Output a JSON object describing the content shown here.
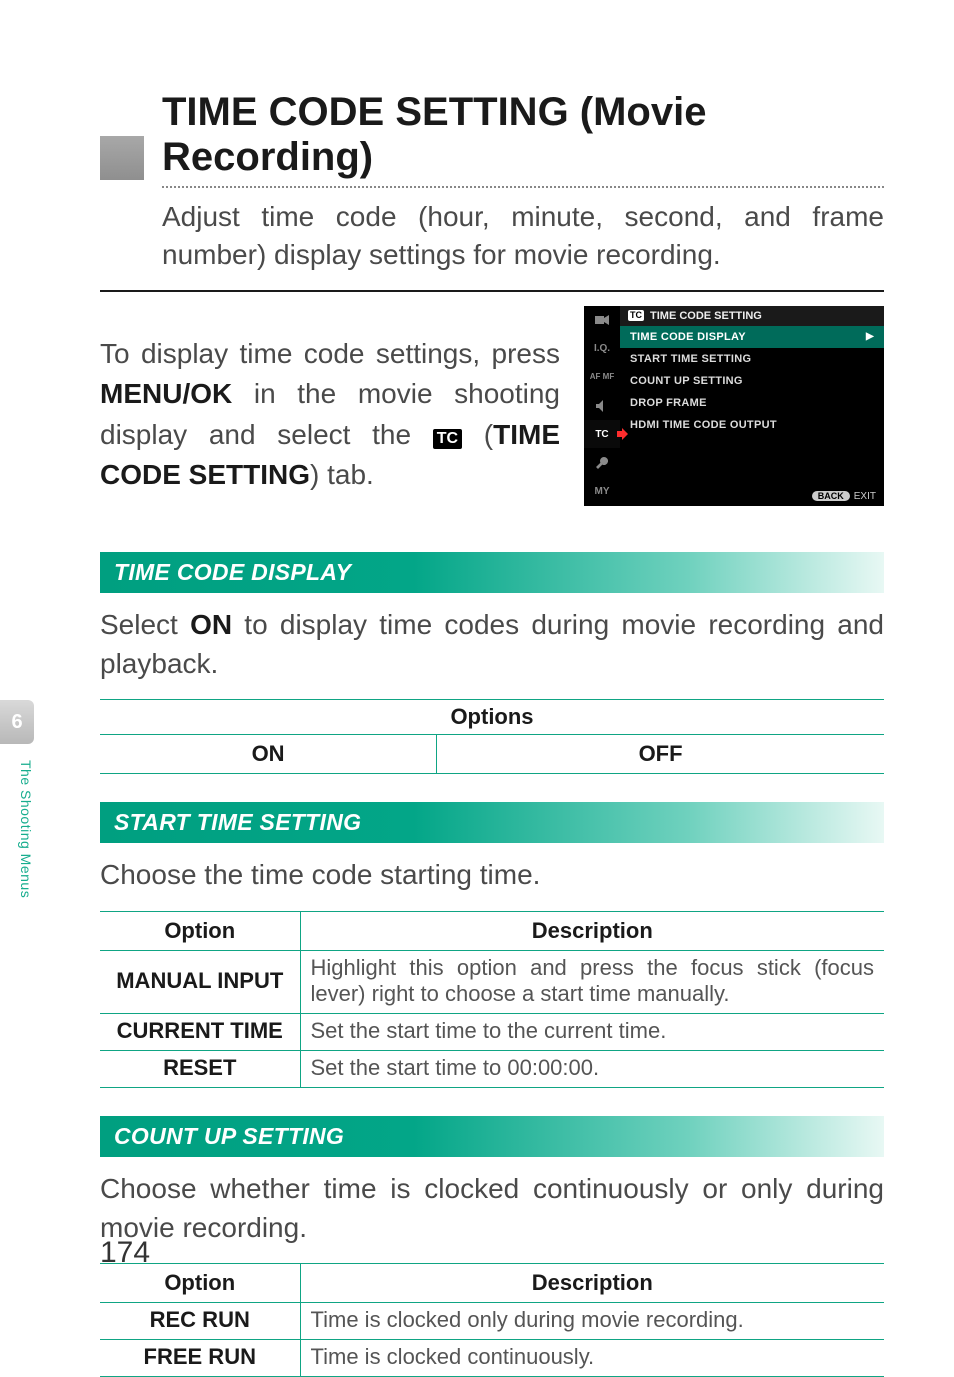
{
  "domain": "Document",
  "page_number": "174",
  "chapter_tab": {
    "num": "6",
    "label": "The Shooting Menus"
  },
  "title": "TIME CODE SETTING (Movie Recording)",
  "lead": "Adjust time code (hour, minute, second, and frame number) display settings for movie recording.",
  "step": {
    "pre": "To display time code settings, press ",
    "menu_ok": "MENU/OK",
    "mid": " in the movie shooting display and select the ",
    "tc_glyph": "TC",
    "setting_name": "TIME CODE SETTING",
    "post": ") tab."
  },
  "osd": {
    "header_glyph": "TC",
    "header": "TIME CODE SETTING",
    "gutter": [
      {
        "label": "",
        "kind": "movie"
      },
      {
        "label": "I.Q."
      },
      {
        "label": "AF\nMF"
      },
      {
        "label": "",
        "kind": "audio"
      },
      {
        "label": "TC",
        "active": true
      },
      {
        "label": "",
        "kind": "wrench"
      },
      {
        "label": "MY"
      }
    ],
    "items": [
      {
        "label": "TIME CODE DISPLAY",
        "selected": true
      },
      {
        "label": "START TIME SETTING"
      },
      {
        "label": "COUNT UP SETTING"
      },
      {
        "label": "DROP FRAME"
      },
      {
        "label": "HDMI TIME CODE OUTPUT"
      }
    ],
    "footer_back": "BACK",
    "footer_exit": "EXIT"
  },
  "sections": [
    {
      "key": "tcd",
      "heading": "TIME CODE DISPLAY",
      "body_pre": "Select ",
      "body_bold": "ON",
      "body_post": " to display time codes during movie recording and playback.",
      "options_header": "Options",
      "options": [
        "ON",
        "OFF"
      ]
    },
    {
      "key": "sts",
      "heading": "START TIME SETTING",
      "body": "Choose the time code starting time.",
      "table": {
        "head": [
          "Option",
          "Description"
        ],
        "rows": [
          [
            "MANUAL INPUT",
            "Highlight this option and press the focus stick (focus lever) right to choose a start time manually."
          ],
          [
            "CURRENT TIME",
            "Set the start time to the current time."
          ],
          [
            "RESET",
            "Set the start time to 00:00:00."
          ]
        ]
      }
    },
    {
      "key": "cus",
      "heading": "COUNT UP SETTING",
      "body": "Choose whether time is clocked continuously or only during movie recording.",
      "table": {
        "head": [
          "Option",
          "Description"
        ],
        "rows": [
          [
            "REC RUN",
            "Time is clocked only during movie recording."
          ],
          [
            "FREE RUN",
            "Time is clocked continuously."
          ]
        ]
      }
    }
  ]
}
